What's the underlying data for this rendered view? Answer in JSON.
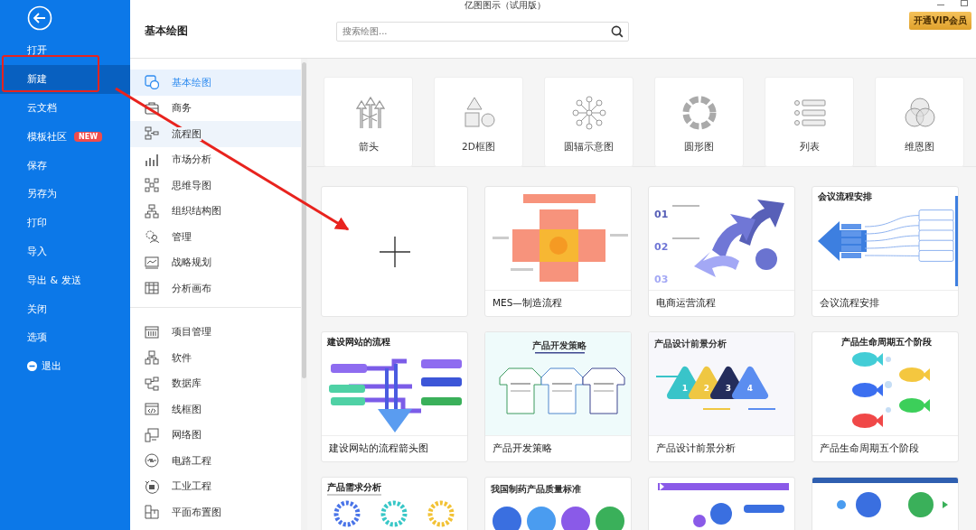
{
  "window": {
    "title": "亿图图示（试用版）"
  },
  "sidebar": {
    "items": [
      {
        "label": "打开",
        "selected": false,
        "kind": "plain"
      },
      {
        "label": "新建",
        "selected": true,
        "kind": "plain"
      },
      {
        "label": "云文档",
        "selected": false,
        "kind": "plain"
      },
      {
        "label": "模板社区",
        "selected": false,
        "kind": "plain",
        "badge": "NEW"
      },
      {
        "label": "保存",
        "selected": false,
        "kind": "plain"
      },
      {
        "label": "另存为",
        "selected": false,
        "kind": "plain"
      },
      {
        "label": "打印",
        "selected": false,
        "kind": "plain"
      },
      {
        "label": "导入",
        "selected": false,
        "kind": "plain"
      },
      {
        "label": "导出 & 发送",
        "selected": false,
        "kind": "plain"
      },
      {
        "label": "关闭",
        "selected": false,
        "kind": "plain"
      },
      {
        "label": "选项",
        "selected": false,
        "kind": "plain"
      },
      {
        "label": "退出",
        "selected": false,
        "kind": "exit"
      }
    ]
  },
  "header": {
    "title": "基本绘图",
    "search": {
      "placeholder": "搜索绘图..."
    },
    "vip_button": "开通VIP会员"
  },
  "categories": {
    "groups": [
      [
        {
          "label": "基本绘图",
          "selected": true,
          "hovered": false
        },
        {
          "label": "商务",
          "selected": false,
          "hovered": false
        },
        {
          "label": "流程图",
          "selected": false,
          "hovered": true
        },
        {
          "label": "市场分析",
          "selected": false,
          "hovered": false
        },
        {
          "label": "思维导图",
          "selected": false,
          "hovered": false
        },
        {
          "label": "组织结构图",
          "selected": false,
          "hovered": false
        },
        {
          "label": "管理",
          "selected": false,
          "hovered": false
        },
        {
          "label": "战略规划",
          "selected": false,
          "hovered": false
        },
        {
          "label": "分析画布",
          "selected": false,
          "hovered": false
        }
      ],
      [
        {
          "label": "项目管理",
          "selected": false,
          "hovered": false
        },
        {
          "label": "软件",
          "selected": false,
          "hovered": false
        },
        {
          "label": "数据库",
          "selected": false,
          "hovered": false
        },
        {
          "label": "线框图",
          "selected": false,
          "hovered": false
        },
        {
          "label": "网络图",
          "selected": false,
          "hovered": false
        },
        {
          "label": "电路工程",
          "selected": false,
          "hovered": false
        },
        {
          "label": "工业工程",
          "selected": false,
          "hovered": false
        },
        {
          "label": "平面布置图",
          "selected": false,
          "hovered": false
        }
      ]
    ]
  },
  "shape_types": [
    {
      "label": "箭头"
    },
    {
      "label": "2D框图"
    },
    {
      "label": "圆辐示意图"
    },
    {
      "label": "圆形图"
    },
    {
      "label": "列表"
    },
    {
      "label": "维恩图"
    }
  ],
  "templates": [
    {
      "kind": "blank"
    },
    {
      "kind": "cross",
      "title": "MES—制造流程"
    },
    {
      "kind": "arrows",
      "title": "电商运营流程",
      "marks": [
        "01",
        "02",
        "03"
      ]
    },
    {
      "kind": "tree",
      "title": "会议流程安排",
      "heading": "会议流程安排"
    },
    {
      "kind": "flow",
      "title": "建设网站的流程箭头图",
      "heading": "建设网站的流程"
    },
    {
      "kind": "shirts",
      "title": "产品开发策略",
      "heading": "产品开发策略"
    },
    {
      "kind": "triangles",
      "title": "产品设计前景分析",
      "heading": "产品设计前景分析",
      "marks": [
        "1",
        "2",
        "3",
        "4"
      ]
    },
    {
      "kind": "fish",
      "title": "产品生命周期五个阶段",
      "heading": "产品生命周期五个阶段"
    },
    {
      "kind": "gears",
      "heading": "产品需求分析"
    },
    {
      "kind": "rings",
      "heading": "我国制药产品质量标准"
    },
    {
      "kind": "bubbles"
    },
    {
      "kind": "nodes"
    }
  ]
}
